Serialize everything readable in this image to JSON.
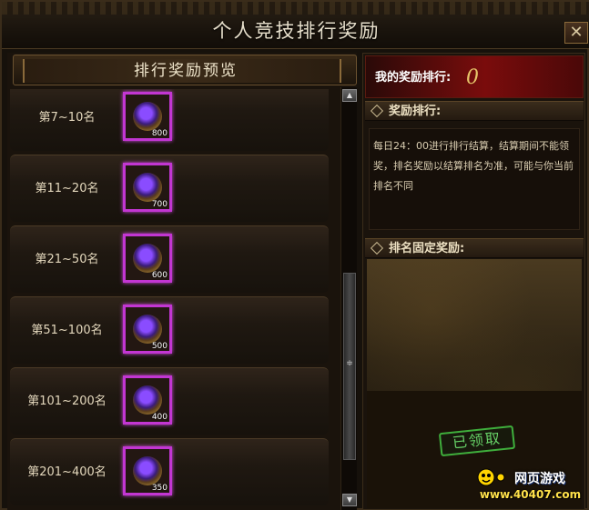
{
  "window": {
    "title": "个人竞技排行奖励",
    "close_glyph": "✕"
  },
  "left": {
    "header": "排行奖励预览",
    "rows": [
      {
        "rank": "第7~10名",
        "qty": "800"
      },
      {
        "rank": "第11~20名",
        "qty": "700"
      },
      {
        "rank": "第21~50名",
        "qty": "600"
      },
      {
        "rank": "第51~100名",
        "qty": "500"
      },
      {
        "rank": "第101~200名",
        "qty": "400"
      },
      {
        "rank": "第201~400名",
        "qty": "350"
      }
    ]
  },
  "right": {
    "my_rank_label": "我的奖励排行:",
    "my_rank_value": "0",
    "section_rank_label": "奖励排行:",
    "rule_text": "每日24：00进行排行结算，结算期间不能领奖，排名奖励以结算排名为准，可能与你当前排名不同",
    "section_fixed_label": "排名固定奖励:",
    "claimed_label": "已领取"
  },
  "watermark": {
    "brand": "网页游戏",
    "url": "www.40407.com"
  },
  "colors": {
    "item_border": "#c236d2",
    "my_rank_bg": "#7a0c0c",
    "claimed": "#3fae3c"
  }
}
